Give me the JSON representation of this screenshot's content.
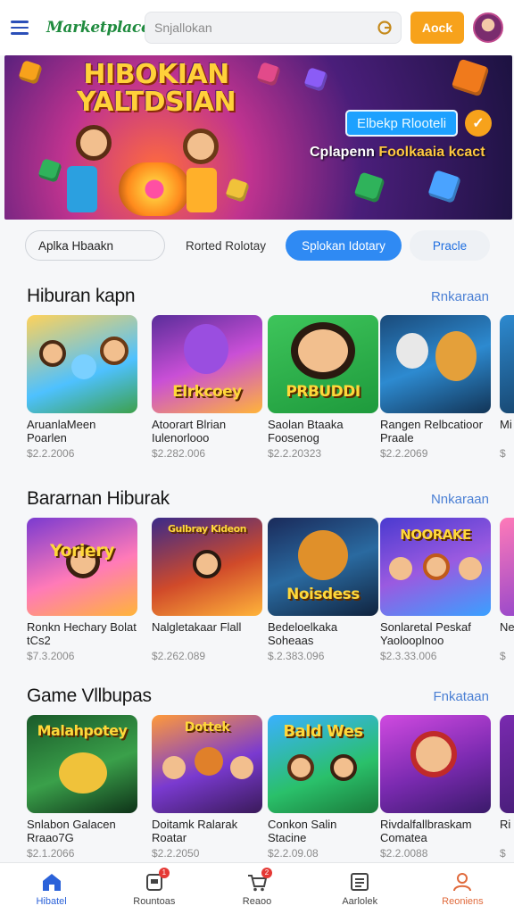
{
  "header": {
    "logo": "Marketplace",
    "search_placeholder": "Snjallokan",
    "cta_label": "Aock"
  },
  "banner": {
    "title": "HIBOKIAN YALTDSIAN",
    "button_label": "Elbekp Rlooteli",
    "subtitle_prefix": "Cplapenn ",
    "subtitle_highlight": "Foolkaaia kcact"
  },
  "filters": [
    {
      "label": "Aplka Hbaakn"
    },
    {
      "label": "Rorted Rolotay"
    },
    {
      "label": "Splokan Idotary"
    },
    {
      "label": "Pracle"
    }
  ],
  "sections": [
    {
      "title": "Hiburan kapn",
      "link": "Rnkaraan",
      "items": [
        {
          "title": "AruanlaMeen Poarlen",
          "price": "$2.2.2006",
          "word": ""
        },
        {
          "title": "Atoorart Blrian Iulenorlooo",
          "price": "$2.282.006",
          "word": "Elrkcoey"
        },
        {
          "title": "Saolan Btaaka Foosenog",
          "price": "$2.2.20323",
          "word": "PRBUDDI"
        },
        {
          "title": "Rangen Relbcatioor Praale",
          "price": "$2.2.2069",
          "word": ""
        },
        {
          "title": "Mi Te",
          "price": "$",
          "word": ""
        }
      ]
    },
    {
      "title": "Bararnan Hiburak",
      "link": "Nnkaraan",
      "items": [
        {
          "title": "Ronkn Hechary Bolat tCs2",
          "price": "$7.3.2006",
          "word": "Yoriery"
        },
        {
          "title": "Nalgletakaar Flall",
          "price": "$2.262.089",
          "word": "Gulbray Kideon"
        },
        {
          "title": "Bedeloelkaka Soheaas",
          "price": "$.2.383.096",
          "word": "Noisdess"
        },
        {
          "title": "Sonlaretal Peskaf Yaolooplnoo",
          "price": "$2.3.33.006",
          "word": "NOORAKE"
        },
        {
          "title": "Ne Gs",
          "price": "$",
          "word": ""
        }
      ]
    },
    {
      "title": "Game Vllbupas",
      "link": "Fnkataan",
      "items": [
        {
          "title": "Snlabon Galacen Rraao7G",
          "price": "$2.1.2066",
          "word": "Malahpotey"
        },
        {
          "title": "Doitamk Ralarak Roatar",
          "price": "$2.2.2050",
          "word": "Dottek"
        },
        {
          "title": "Conkon Salin Stacine",
          "price": "$2.2.09.08",
          "word": "Bald Wes"
        },
        {
          "title": "Rivdalfallbraskam Comatea",
          "price": "$2.2.0088",
          "word": ""
        },
        {
          "title": "Ri Ir",
          "price": "$",
          "word": ""
        }
      ]
    }
  ],
  "bottom_nav": [
    {
      "label": "Hibatel",
      "icon": "home-icon",
      "badge": ""
    },
    {
      "label": "Rountoas",
      "icon": "gamepad-icon",
      "badge": "1"
    },
    {
      "label": "Reaoo",
      "icon": "cart-icon",
      "badge": "2"
    },
    {
      "label": "Aarlolek",
      "icon": "list-icon",
      "badge": ""
    },
    {
      "label": "Reoniens",
      "icon": "profile-icon",
      "badge": ""
    }
  ]
}
